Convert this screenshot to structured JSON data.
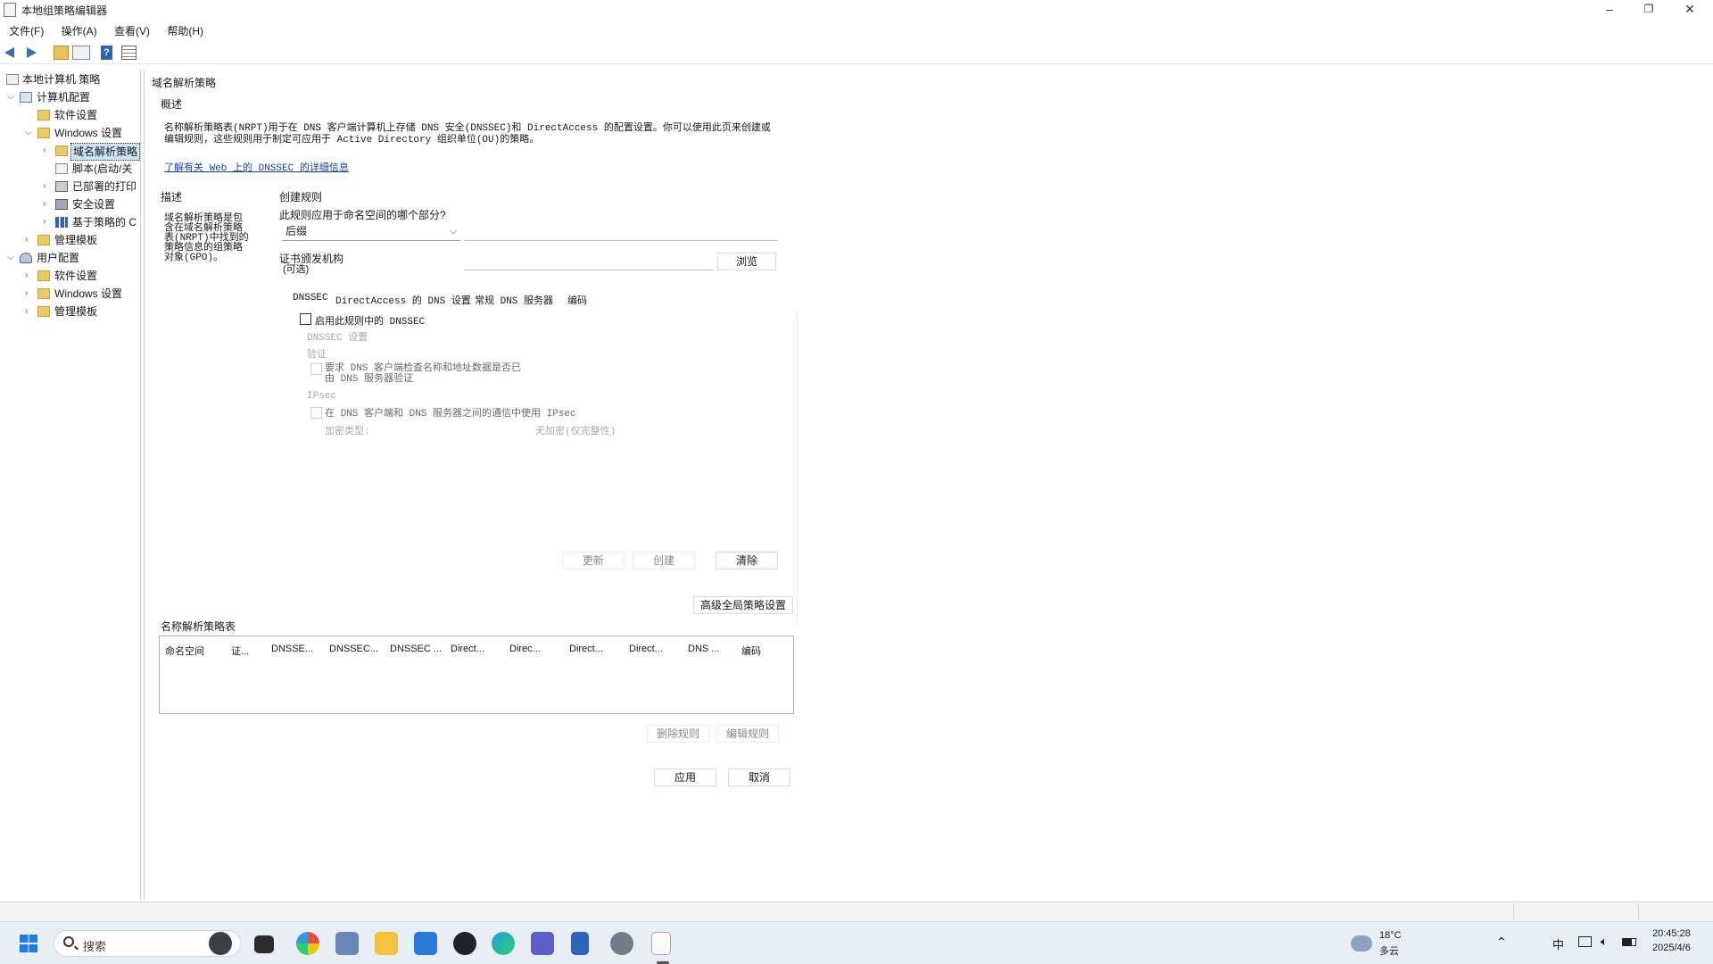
{
  "window": {
    "title": "本地组策略编辑器",
    "minimize": "–",
    "maximize": "❐",
    "close": "✕"
  },
  "menu": [
    "文件(F)",
    "操作(A)",
    "查看(V)",
    "帮助(H)"
  ],
  "toolbar_icons": [
    "back-arrow-icon",
    "forward-arrow-icon",
    "folder-up-icon",
    "properties-icon",
    "help-icon",
    "view-icon"
  ],
  "tree": [
    {
      "label": "本地计算机 策略",
      "icon": "policy-icon"
    },
    {
      "label": "计算机配置",
      "icon": "computer-icon"
    },
    {
      "label": "软件设置",
      "icon": "folder-icon"
    },
    {
      "label": "Windows 设置",
      "icon": "folder-icon"
    },
    {
      "label": "域名解析策略",
      "icon": "folder-icon"
    },
    {
      "label": "脚本(启动/关",
      "icon": "script-icon"
    },
    {
      "label": "已部署的打印",
      "icon": "printer-icon"
    },
    {
      "label": "安全设置",
      "icon": "security-icon"
    },
    {
      "label": "基于策略的 C",
      "icon": "chart-icon"
    },
    {
      "label": "管理模板",
      "icon": "folder-icon"
    },
    {
      "label": "用户配置",
      "icon": "user-icon"
    },
    {
      "label": "软件设置",
      "icon": "folder-icon"
    },
    {
      "label": "Windows 设置",
      "icon": "folder-icon"
    },
    {
      "label": "管理模板",
      "icon": "folder-icon"
    }
  ],
  "panel": {
    "heading": "域名解析策略",
    "overview_label": "概述",
    "overview_line1": "名称解析策略表(NRPT)用于在 DNS 客户端计算机上存储 DNS 安全(DNSSEC)和 DirectAccess 的配置设置。你可以使用此页来创建或",
    "overview_line2": "编辑规则，这些规则用于制定可应用于 Active Directory 组织单位(OU)的策略。",
    "learn_more_link": "了解有关 Web 上的 DNSSEC 的详细信息",
    "description_label": "描述",
    "description_lines": [
      "域名解析策略是包",
      "含在域名解析策略",
      "表(NRPT)中找到的",
      "策略信息的组策略",
      "对象(GPO)。"
    ],
    "create_rules_label": "创建规则",
    "namespace_question": "此规则应用于命名空间的哪个部分?",
    "namespace_select": "后缀",
    "namespace_value": "",
    "cert_label_line1": "证书颁发机构",
    "cert_label_line2": "(可选)",
    "cert_value": "",
    "browse_button": "浏览",
    "tabs": [
      "DNSSEC",
      "DirectAccess 的 DNS 设置",
      "常规 DNS 服务器",
      "编码"
    ],
    "enable_dnssec_label": "启用此规则中的 DNSSEC",
    "enable_dnssec_checked": false,
    "dnssec_settings_label": "DNSSEC 设置",
    "validation_label": "验证",
    "validation_option_line1": "要求 DNS 客户端检查名称和地址数据是否已",
    "validation_option_line2": "由 DNS 服务器验证",
    "ipsec_label": "IPsec",
    "ipsec_option": "在 DNS 客户端和 DNS 服务器之间的通信中使用 IPsec",
    "encryption_type_label": "加密类型:",
    "encryption_type_value": "无加密(仅完整性)",
    "update_button": "更新",
    "create_button": "创建",
    "clear_button": "清除",
    "advanced_button": "高级全局策略设置",
    "table_label": "名称解析策略表",
    "table_columns": [
      "命名空间",
      "证...",
      "DNSSE...",
      "DNSSEC...",
      "DNSSEC ...",
      "Direct...",
      "Direc...",
      "Direct...",
      "Direct...",
      "DNS ...",
      "编码"
    ],
    "table_rows": [],
    "delete_rule_button": "删除规则",
    "edit_rule_button": "编辑规则",
    "apply_button": "应用",
    "cancel_button": "取消"
  },
  "taskbar": {
    "search_placeholder": "搜索",
    "weather_temp": "18°C",
    "weather_desc": "多云",
    "ime": "中",
    "time": "20:45:28",
    "date": "2025/4/6",
    "app_icons": [
      "copilot-icon",
      "file-manager-icon",
      "color-app-icon",
      "desktop-app-icon",
      "file-explorer-icon",
      "calendar-icon",
      "browser-icon",
      "edge-icon",
      "teams-icon",
      "notepad-icon",
      "settings-icon",
      "policy-editor-icon"
    ]
  }
}
